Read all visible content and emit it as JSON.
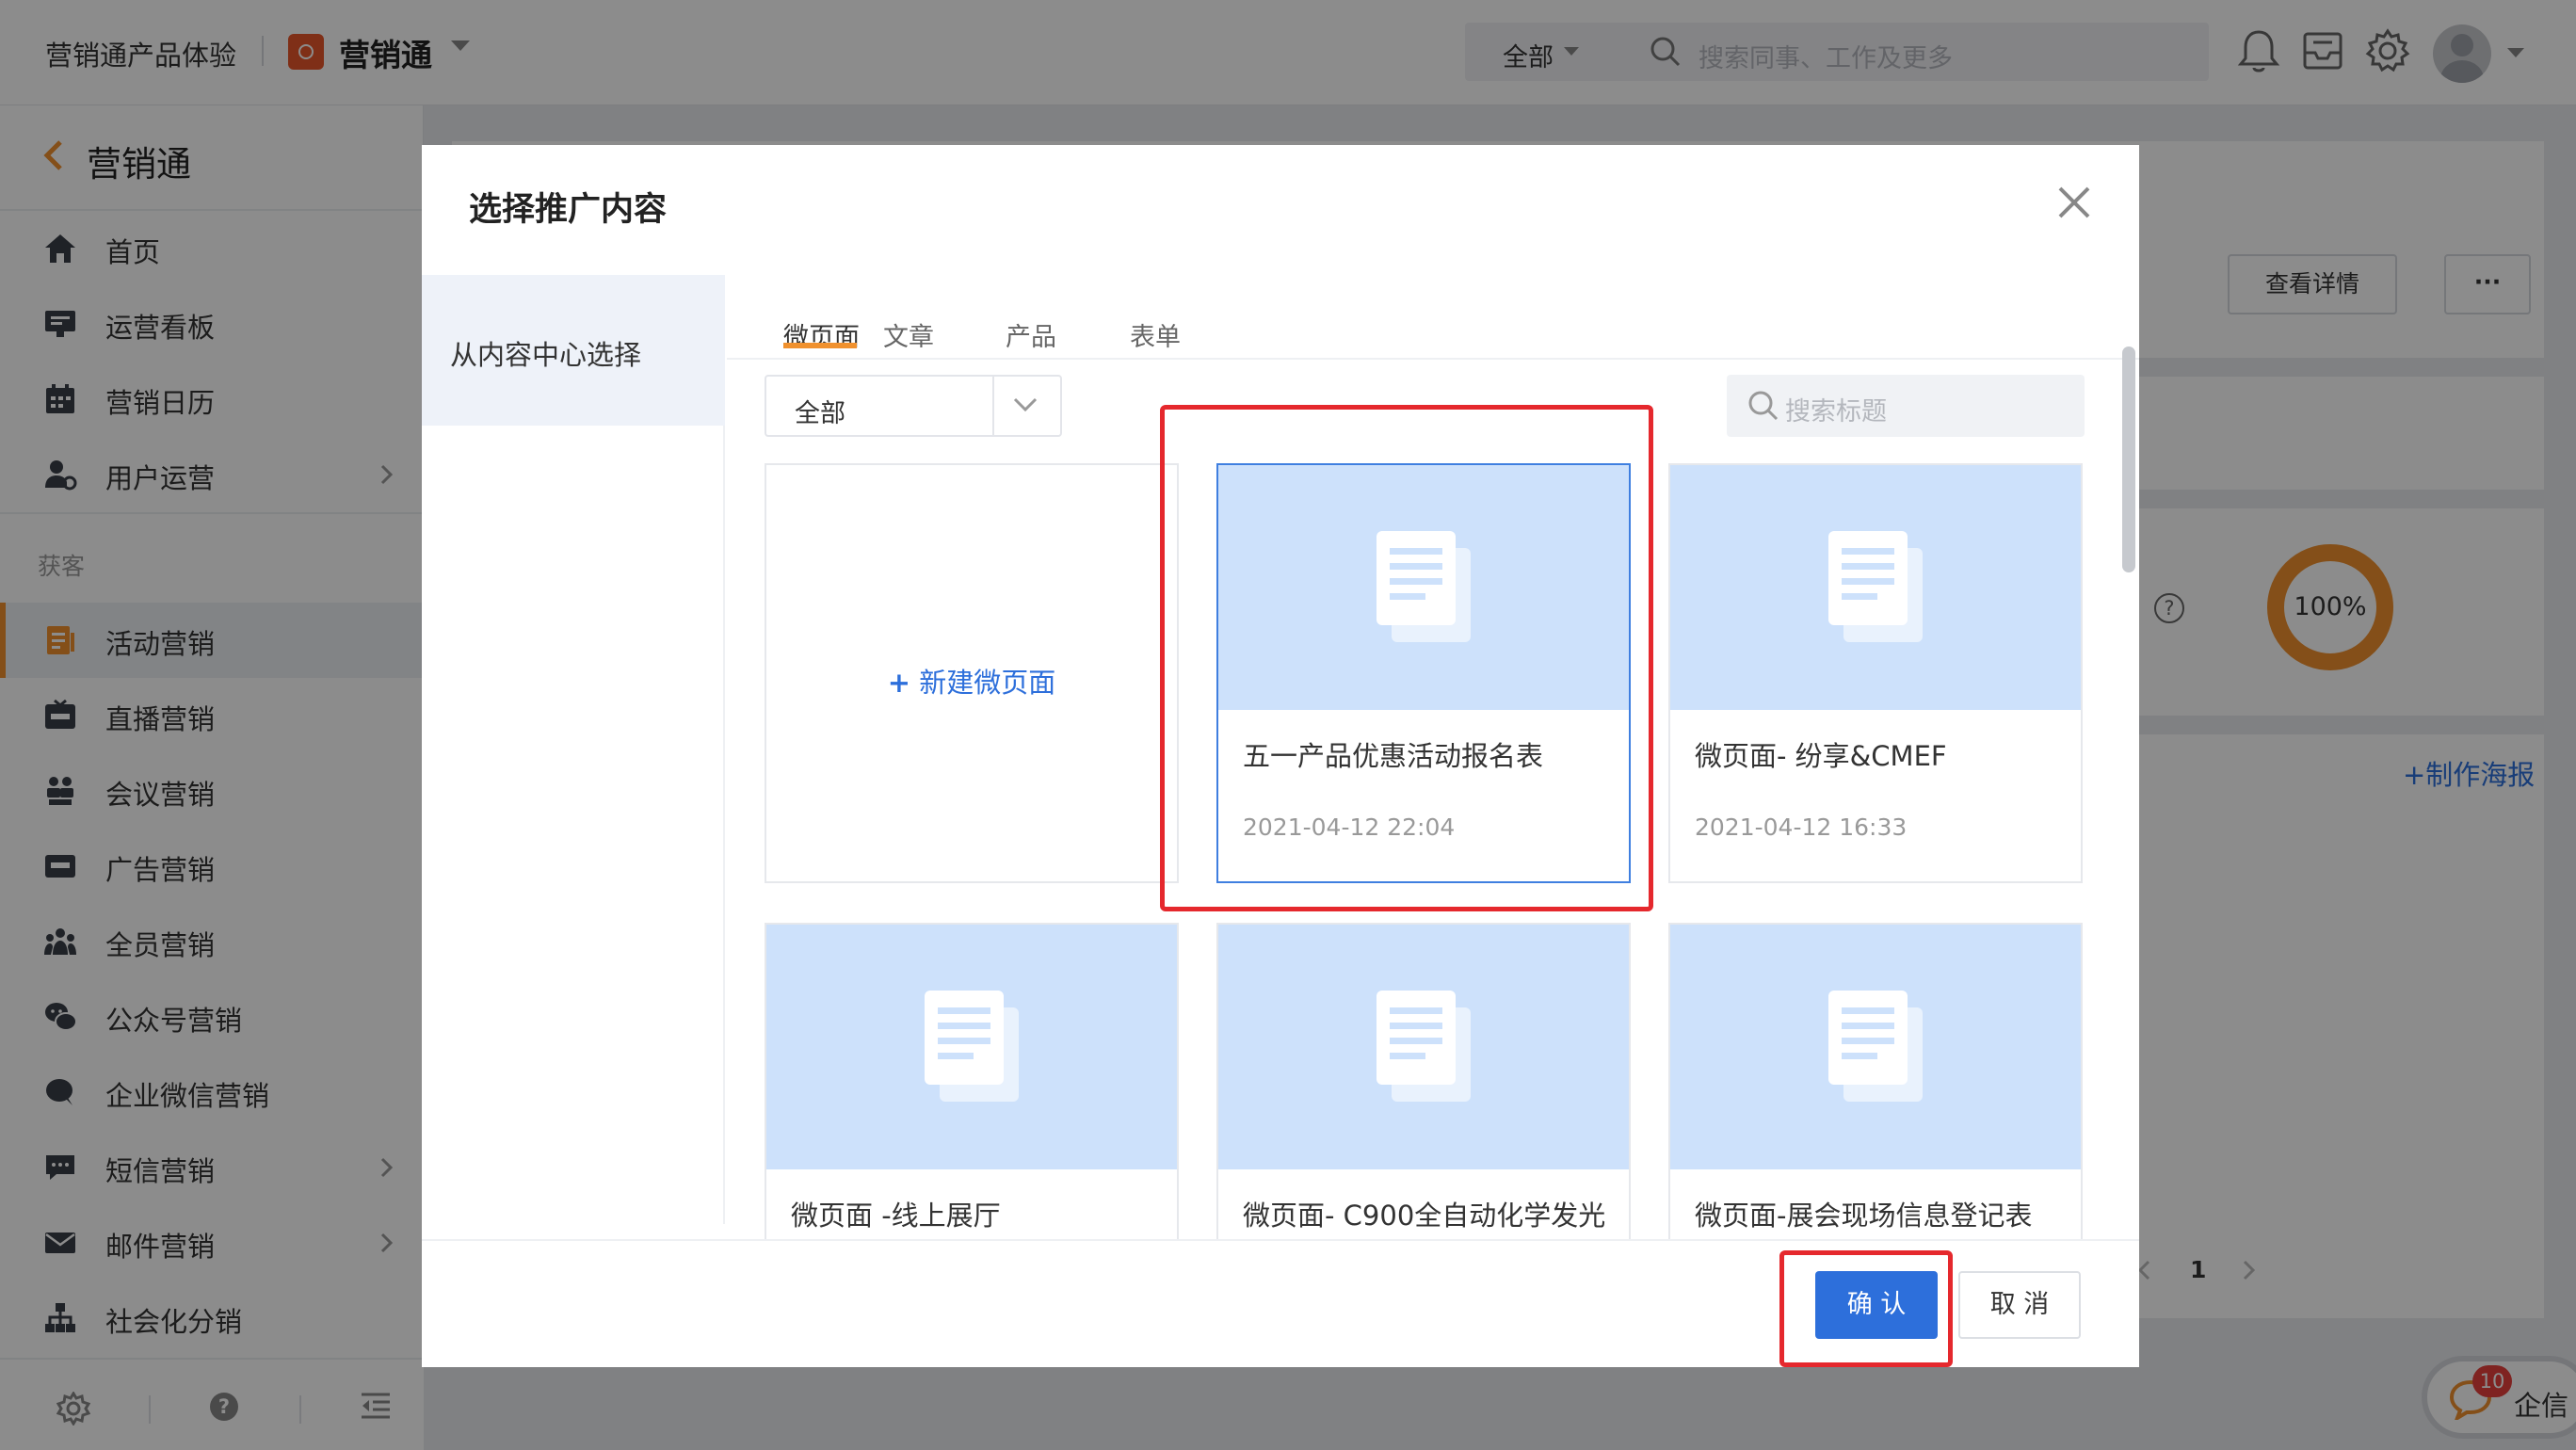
{
  "topbar": {
    "product_name": "营销通产品体验",
    "app_name": "营销通",
    "search_scope": "全部",
    "search_placeholder": "搜索同事、工作及更多",
    "icons": [
      "bell-icon",
      "inbox-icon",
      "gear-icon",
      "avatar"
    ]
  },
  "sidebar": {
    "title": "营销通",
    "items": [
      {
        "label": "首页",
        "icon": "home-icon"
      },
      {
        "label": "运营看板",
        "icon": "dashboard-icon"
      },
      {
        "label": "营销日历",
        "icon": "calendar-icon"
      },
      {
        "label": "用户运营",
        "icon": "user-ops-icon",
        "has_children": true
      },
      {
        "label": "活动营销",
        "icon": "activity-icon",
        "active": true
      },
      {
        "label": "直播营销",
        "icon": "live-icon"
      },
      {
        "label": "会议营销",
        "icon": "meeting-icon"
      },
      {
        "label": "广告营销",
        "icon": "ad-icon"
      },
      {
        "label": "全员营销",
        "icon": "team-icon"
      },
      {
        "label": "公众号营销",
        "icon": "wechat-icon"
      },
      {
        "label": "企业微信营销",
        "icon": "work-wechat-icon"
      },
      {
        "label": "短信营销",
        "icon": "sms-icon",
        "has_children": true
      },
      {
        "label": "邮件营销",
        "icon": "mail-icon",
        "has_children": true
      },
      {
        "label": "社会化分销",
        "icon": "distribution-icon"
      }
    ],
    "group_label": "获客"
  },
  "background": {
    "details_button": "查看详情",
    "more_button": "···",
    "donut_value": "100%",
    "make_poster": "+制作海报",
    "current_page": "1",
    "chat_badge": "10",
    "chat_label": "企信"
  },
  "modal": {
    "title": "选择推广内容",
    "left_item": "从内容中心选择",
    "tabs": [
      {
        "label": "微页面",
        "active": true
      },
      {
        "label": "文章"
      },
      {
        "label": "产品"
      },
      {
        "label": "表单"
      }
    ],
    "filter_value": "全部",
    "search_placeholder": "搜索标题",
    "new_page_label": "新建微页面",
    "cards": [
      {
        "title": "五一产品优惠活动报名表",
        "date": "2021-04-12 22:04",
        "selected": true
      },
      {
        "title": "微页面- 纷享&CMEF",
        "date": "2021-04-12 16:33"
      },
      {
        "title": "微页面 -线上展厅",
        "date": ""
      },
      {
        "title": "微页面- C900全自动化学发光",
        "date": ""
      },
      {
        "title": "微页面-展会现场信息登记表",
        "date": ""
      }
    ],
    "confirm_label": "确 认",
    "cancel_label": "取 消"
  },
  "colors": {
    "accent": "#f0912e",
    "primary": "#2d6fdb",
    "thumb_bg": "#cde1fb",
    "highlight": "#e5282d"
  }
}
